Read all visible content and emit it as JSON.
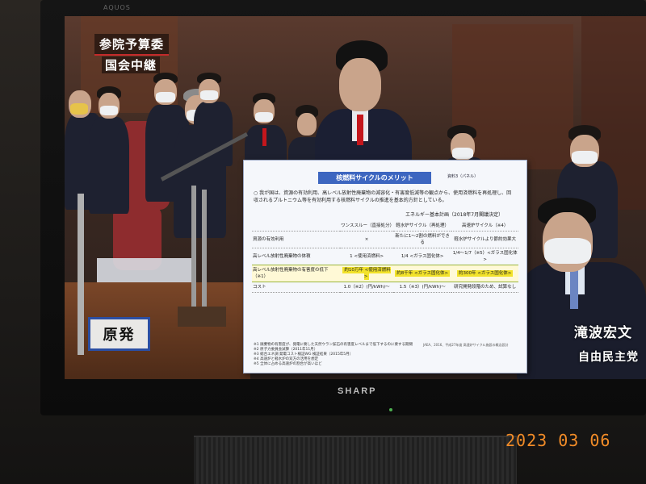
{
  "tv": {
    "brand": "SHARP",
    "brand_top": "AQUOS"
  },
  "broadcast": {
    "program_title": "参院予算委",
    "program_subtitle": "国会中継",
    "topic_caption": "原発",
    "speaker_name": "滝波宏文",
    "speaker_party": "自由民主党"
  },
  "slide": {
    "title": "核燃料サイクルのメリット",
    "source": "資料3（パネル）",
    "intro": "○ 我が国は、資源の有効利用、高レベル放射性廃棄物の減容化・有害度低減等の観点から、使用済燃料を再処理し、回収されるプルトニウム等を有効利用する核燃料サイクルの推進を基本的方針としている。",
    "intro_ref": "エネルギー基本計画（2018年7月閣議決定）",
    "columns": [
      "",
      "ワンススルー（直接処分）",
      "軽水炉サイクル（再処理）",
      "高速炉サイクル（※4）"
    ],
    "rows": [
      {
        "label": "資源の有効利用",
        "values": [
          "×",
          "新たに1〜2割の燃料ができる",
          "軽水炉サイクルより節約効果大"
        ]
      },
      {
        "label": "高レベル放射性廃棄物の体積",
        "values": [
          "1 <使用済燃料>",
          "1/4 <ガラス固化体>",
          "1/4〜1/7（※5）<ガラス固化体>"
        ]
      },
      {
        "label": "高レベル放射性廃棄物の有害度の低下（※1）",
        "values": [
          "約10万年 <使用済燃料>",
          "約8千年 <ガラス固化体>",
          "約300年 <ガラス固化体>"
        ],
        "highlight": true
      },
      {
        "label": "コスト",
        "values": [
          "1.0（※2）(円/kWh)〜",
          "1.5（※3）(円/kWh)〜",
          "研究開発段階のため、試算なし"
        ]
      }
    ],
    "notes": "※1 廃棄物の有害度が、発電に要した天然ウラン鉱石の有害度レベルまで低下するのに要する期間\n※2 原子力委員会試算（2011年11月）\n※3 総合エネ調 発電コスト検証WG 検証結果（2015年5月）\n※4 高速炉と軽水炉の双方の活用を想定\n※5 全体に占める高速炉の割合が高いほど",
    "notes_side": "JAEA、2016、平成27年度 高速炉サイクル施設の概念設計"
  },
  "date_stamp": "2023 03 06",
  "colors": {
    "slide_title_bg": "#3d66c0",
    "highlight": "#f2e229",
    "date_stamp": "#f28c28",
    "caption_border": "#2b4ea2"
  }
}
